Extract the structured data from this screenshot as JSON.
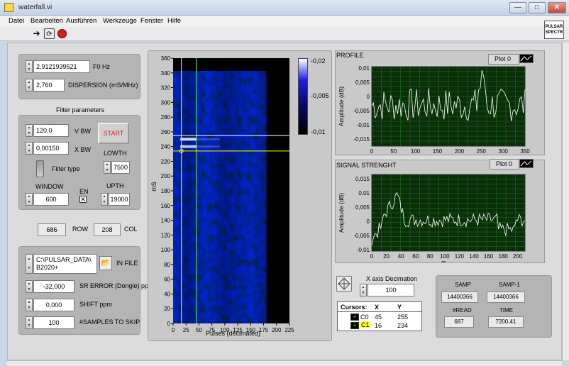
{
  "window": {
    "title": "waterfall.vi",
    "minimize": "—",
    "maximize": "□",
    "close": "✕"
  },
  "menu": [
    "Datei",
    "Bearbeiten",
    "Ausführen",
    "Werkzeuge",
    "Fenster",
    "Hilfe"
  ],
  "toolbar": {
    "run_icon": "run-arrow-icon",
    "run_continuous_icon": "run-continuous-icon",
    "abort_icon": "abort-icon"
  },
  "corner_icon": {
    "line1": "PULSAR",
    "line2": "SPECTR"
  },
  "controls": {
    "f0": {
      "value": "2,9121939521",
      "label": "F0 Hz"
    },
    "dispersion": {
      "value": "2,760",
      "label": "DISPERSION (mS/MHz)"
    },
    "filter_title": "Filter parameters",
    "vbw": {
      "value": "120,0",
      "label": "V BW"
    },
    "xbw": {
      "value": "0,00150",
      "label": "X BW"
    },
    "start": "START",
    "lowth": {
      "label": "LOWTH",
      "value": "7500"
    },
    "filter_type": "Filter type",
    "window": {
      "label": "WINDOW",
      "value": "600"
    },
    "en": {
      "label": "EN",
      "check": "✕"
    },
    "upth": {
      "label": "UPTH",
      "value": "19000"
    },
    "row": {
      "value": "686",
      "label": "ROW"
    },
    "col": {
      "value": "208",
      "label": "COL"
    },
    "in_file": {
      "value_line1": "C:\\PULSAR_DATA\\",
      "value_line2": "B2020+",
      "label": "IN FILE"
    },
    "sr_error": {
      "value": "-32,000",
      "label": "SR ERROR (Dongle) ppm"
    },
    "shift": {
      "value": "0,000",
      "label": "SHIFT ppm"
    },
    "samples_skip": {
      "value": "100",
      "label": "#SAMPLES TO SKIP"
    }
  },
  "waterfall": {
    "ylabel": "mS",
    "xlabel": "Pulses (decimated)",
    "yticks": [
      "360",
      "340",
      "320",
      "300",
      "280",
      "260",
      "240",
      "220",
      "200",
      "180",
      "160",
      "140",
      "120",
      "100",
      "80",
      "60",
      "40",
      "20",
      "0"
    ],
    "xticks": [
      "0",
      "25",
      "50",
      "75",
      "100",
      "125",
      "150",
      "175",
      "200",
      "225"
    ],
    "colorbar_ticks": [
      "-0,02",
      "-0,005",
      "-0,01"
    ],
    "cursor_colors": {
      "c0": "#ffffff",
      "c1": "#ffff00",
      "cross_v": "#66ff66"
    }
  },
  "profile": {
    "title": "PROFILE",
    "legend": "Plot 0",
    "ylabel": "Amplitude (dB)",
    "xlabel": "Time",
    "yticks": [
      "0,01",
      "0,005",
      "0",
      "-0,005",
      "-0,01",
      "-0,015"
    ],
    "xticks": [
      "0",
      "50",
      "100",
      "150",
      "200",
      "250",
      "300",
      "350"
    ]
  },
  "signal": {
    "title": "SIGNAL STRENGHT",
    "legend": "Plot 0",
    "ylabel": "Amplitude (dB)",
    "xlabel": "Time",
    "yticks": [
      "0,015",
      "0,01",
      "0,005",
      "0",
      "-0,005",
      "-0,01"
    ],
    "xticks": [
      "0",
      "20",
      "40",
      "60",
      "80",
      "100",
      "120",
      "140",
      "160",
      "180",
      "200"
    ]
  },
  "decimation": {
    "label": "X axis Decimation",
    "value": "100"
  },
  "cursors": {
    "header": [
      "Cursors:",
      "X",
      "Y"
    ],
    "rows": [
      {
        "name": "C0",
        "x": "45",
        "y": "255"
      },
      {
        "name": "C1",
        "x": "16",
        "y": "234"
      }
    ]
  },
  "samp": {
    "samp_label": "SAMP",
    "samp_value": "14400366",
    "samp1_label": "SAMP-1",
    "samp1_value": "14400366",
    "read_label": "#READ",
    "read_value": "687",
    "time_label": "TIME",
    "time_value": "7200,41"
  },
  "colors": {
    "plot_bg": "#0a2e0a",
    "plot_grid": "#1f7a1f",
    "trace": "#ffffff",
    "panel": "#dcdcdc",
    "group": "#b4b4b4"
  }
}
